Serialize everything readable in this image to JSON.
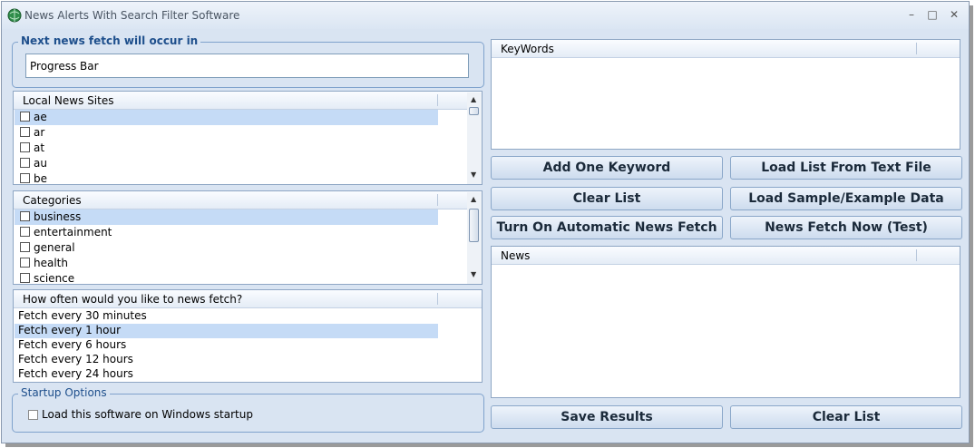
{
  "window": {
    "title": "News Alerts With Search Filter Software"
  },
  "controls": {
    "minimize": "–",
    "maximize": "□",
    "close": "✕"
  },
  "fetch_group": {
    "label": "Next news fetch will occur in",
    "progress_text": "Progress Bar"
  },
  "sites": {
    "header": "Local News Sites",
    "items": [
      "ae",
      "ar",
      "at",
      "au",
      "be"
    ],
    "selected": "ae"
  },
  "categories": {
    "header": "Categories",
    "items": [
      "business",
      "entertainment",
      "general",
      "health",
      "science"
    ],
    "selected": "business"
  },
  "frequency": {
    "header": "How often would you like to news fetch?",
    "items": [
      "Fetch every 30 minutes",
      "Fetch every 1 hour",
      "Fetch every 6 hours",
      "Fetch every 12 hours",
      "Fetch every 24 hours"
    ],
    "selected": "Fetch every 1 hour"
  },
  "startup": {
    "label": "Startup Options",
    "checkbox_label": "Load this software on Windows startup"
  },
  "keywords": {
    "header": "KeyWords"
  },
  "buttons": {
    "add_keyword": "Add One Keyword",
    "load_list": "Load List From Text File",
    "clear_list_top": "Clear List",
    "load_sample": "Load Sample/Example Data",
    "auto_fetch": "Turn On Automatic News Fetch",
    "fetch_now": "News Fetch Now (Test)",
    "save_results": "Save Results",
    "clear_list_bottom": "Clear List"
  },
  "news": {
    "header": "News"
  },
  "colors": {
    "window_bg": "#d9e4f2",
    "accent": "#1e4f8c",
    "selection": "#c5dbf6"
  }
}
